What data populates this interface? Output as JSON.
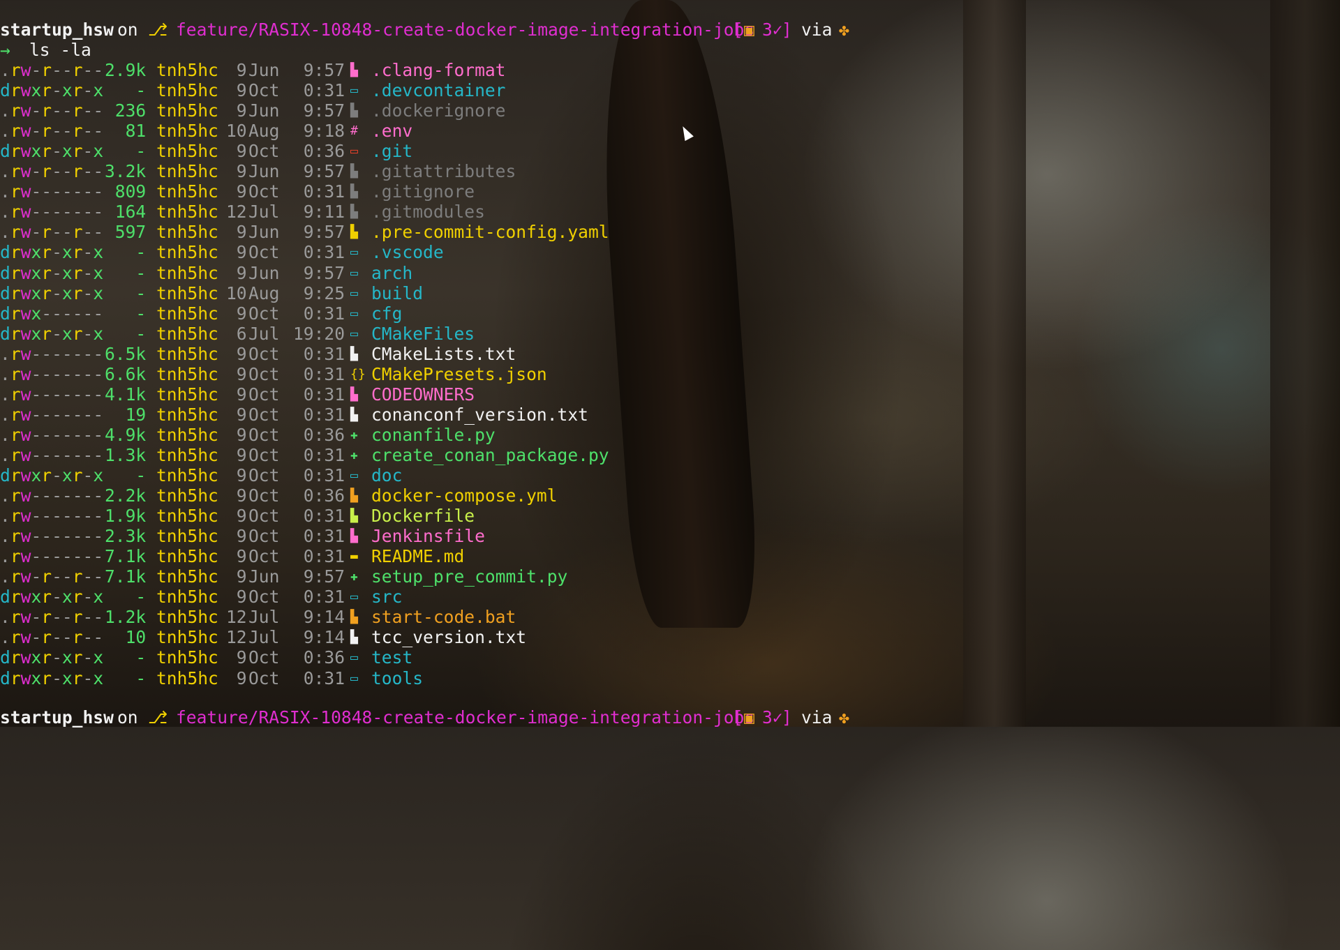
{
  "prompt": {
    "dir": "startup_hsw",
    "on": "on",
    "branch_icon": "git-branch-icon",
    "branch": "feature/RASIX-10848-create-docker-image-integration-jobs",
    "status_open": "[",
    "status_count": "3✓",
    "status_close": "]",
    "via": "via",
    "arrow": "→",
    "command": "ls -la"
  },
  "colors": {
    "perm_dir": "#25b7c8",
    "perm_read": "#f0d000",
    "perm_write": "#e02ed0",
    "perm_exec": "#4ee06a",
    "size": "#4ee06a",
    "user": "#f0d000",
    "date": "#9a9a9a",
    "branch": "#e02ed0"
  },
  "listing": [
    {
      "perm": ".rw-r--r--",
      "size": "2.9k",
      "user": "tnh5hc",
      "day": " 9",
      "month": "Jun",
      "time": " 9:57",
      "icon": "file-icon",
      "iconcolor": "#ff6dcc",
      "name": ".clang-format",
      "namecolor": "#ff6dcc"
    },
    {
      "perm": "drwxr-xr-x",
      "size": "   -",
      "user": "tnh5hc",
      "day": " 9",
      "month": "Oct",
      "time": " 0:31",
      "icon": "folder-icon",
      "iconcolor": "#25b7c8",
      "name": ".devcontainer",
      "namecolor": "#25b7c8"
    },
    {
      "perm": ".rw-r--r--",
      "size": " 236",
      "user": "tnh5hc",
      "day": " 9",
      "month": "Jun",
      "time": " 9:57",
      "icon": "file-icon",
      "iconcolor": "#7d7d7d",
      "name": ".dockerignore",
      "namecolor": "#7d7d7d"
    },
    {
      "perm": ".rw-r--r--",
      "size": "  81",
      "user": "tnh5hc",
      "day": "10",
      "month": "Aug",
      "time": " 9:18",
      "icon": "hash-icon",
      "iconcolor": "#ff6dcc",
      "name": ".env",
      "namecolor": "#ff6dcc"
    },
    {
      "perm": "drwxr-xr-x",
      "size": "   -",
      "user": "tnh5hc",
      "day": " 9",
      "month": "Oct",
      "time": " 0:36",
      "icon": "folder-icon",
      "iconcolor": "#e8402a",
      "name": ".git",
      "namecolor": "#25b7c8"
    },
    {
      "perm": ".rw-r--r--",
      "size": "3.2k",
      "user": "tnh5hc",
      "day": " 9",
      "month": "Jun",
      "time": " 9:57",
      "icon": "file-icon",
      "iconcolor": "#7d7d7d",
      "name": ".gitattributes",
      "namecolor": "#7d7d7d"
    },
    {
      "perm": ".rw-------",
      "size": " 809",
      "user": "tnh5hc",
      "day": " 9",
      "month": "Oct",
      "time": " 0:31",
      "icon": "file-icon",
      "iconcolor": "#7d7d7d",
      "name": ".gitignore",
      "namecolor": "#7d7d7d"
    },
    {
      "perm": ".rw-------",
      "size": " 164",
      "user": "tnh5hc",
      "day": "12",
      "month": "Jul",
      "time": " 9:11",
      "icon": "file-icon",
      "iconcolor": "#7d7d7d",
      "name": ".gitmodules",
      "namecolor": "#7d7d7d"
    },
    {
      "perm": ".rw-r--r--",
      "size": " 597",
      "user": "tnh5hc",
      "day": " 9",
      "month": "Jun",
      "time": " 9:57",
      "icon": "file-icon",
      "iconcolor": "#f0d000",
      "name": ".pre-commit-config.yaml",
      "namecolor": "#f0d000"
    },
    {
      "perm": "drwxr-xr-x",
      "size": "   -",
      "user": "tnh5hc",
      "day": " 9",
      "month": "Oct",
      "time": " 0:31",
      "icon": "folder-icon",
      "iconcolor": "#25b7c8",
      "name": ".vscode",
      "namecolor": "#25b7c8"
    },
    {
      "perm": "drwxr-xr-x",
      "size": "   -",
      "user": "tnh5hc",
      "day": " 9",
      "month": "Jun",
      "time": " 9:57",
      "icon": "folder-icon",
      "iconcolor": "#25b7c8",
      "name": "arch",
      "namecolor": "#25b7c8"
    },
    {
      "perm": "drwxr-xr-x",
      "size": "   -",
      "user": "tnh5hc",
      "day": "10",
      "month": "Aug",
      "time": " 9:25",
      "icon": "folder-icon",
      "iconcolor": "#25b7c8",
      "name": "build",
      "namecolor": "#25b7c8"
    },
    {
      "perm": "drwx------",
      "size": "   -",
      "user": "tnh5hc",
      "day": " 9",
      "month": "Oct",
      "time": " 0:31",
      "icon": "folder-icon",
      "iconcolor": "#25b7c8",
      "name": "cfg",
      "namecolor": "#25b7c8"
    },
    {
      "perm": "drwxr-xr-x",
      "size": "   -",
      "user": "tnh5hc",
      "day": " 6",
      "month": "Jul",
      "time": "19:20",
      "icon": "folder-icon",
      "iconcolor": "#25b7c8",
      "name": "CMakeFiles",
      "namecolor": "#25b7c8"
    },
    {
      "perm": ".rw-------",
      "size": "6.5k",
      "user": "tnh5hc",
      "day": " 9",
      "month": "Oct",
      "time": " 0:31",
      "icon": "file-icon",
      "iconcolor": "#f2f2f2",
      "name": "CMakeLists.txt",
      "namecolor": "#f2f2f2"
    },
    {
      "perm": ".rw-------",
      "size": "6.6k",
      "user": "tnh5hc",
      "day": " 9",
      "month": "Oct",
      "time": " 0:31",
      "icon": "braces-icon",
      "iconcolor": "#f0d000",
      "name": "CMakePresets.json",
      "namecolor": "#f0d000"
    },
    {
      "perm": ".rw-------",
      "size": "4.1k",
      "user": "tnh5hc",
      "day": " 9",
      "month": "Oct",
      "time": " 0:31",
      "icon": "file-icon",
      "iconcolor": "#ff6dcc",
      "name": "CODEOWNERS",
      "namecolor": "#ff6dcc"
    },
    {
      "perm": ".rw-------",
      "size": "  19",
      "user": "tnh5hc",
      "day": " 9",
      "month": "Oct",
      "time": " 0:31",
      "icon": "file-icon",
      "iconcolor": "#f2f2f2",
      "name": "conanconf_version.txt",
      "namecolor": "#f2f2f2"
    },
    {
      "perm": ".rw-------",
      "size": "4.9k",
      "user": "tnh5hc",
      "day": " 9",
      "month": "Oct",
      "time": " 0:36",
      "icon": "python-icon",
      "iconcolor": "#4ee06a",
      "name": "conanfile.py",
      "namecolor": "#4ee06a"
    },
    {
      "perm": ".rw-------",
      "size": "1.3k",
      "user": "tnh5hc",
      "day": " 9",
      "month": "Oct",
      "time": " 0:31",
      "icon": "python-icon",
      "iconcolor": "#4ee06a",
      "name": "create_conan_package.py",
      "namecolor": "#4ee06a"
    },
    {
      "perm": "drwxr-xr-x",
      "size": "   -",
      "user": "tnh5hc",
      "day": " 9",
      "month": "Oct",
      "time": " 0:31",
      "icon": "folder-icon",
      "iconcolor": "#25b7c8",
      "name": "doc",
      "namecolor": "#25b7c8"
    },
    {
      "perm": ".rw-------",
      "size": "2.2k",
      "user": "tnh5hc",
      "day": " 9",
      "month": "Oct",
      "time": " 0:36",
      "icon": "file-icon",
      "iconcolor": "#f0a020",
      "name": "docker-compose.yml",
      "namecolor": "#f0d000"
    },
    {
      "perm": ".rw-------",
      "size": "1.9k",
      "user": "tnh5hc",
      "day": " 9",
      "month": "Oct",
      "time": " 0:31",
      "icon": "file-icon",
      "iconcolor": "#c9f04a",
      "name": "Dockerfile",
      "namecolor": "#c9f04a"
    },
    {
      "perm": ".rw-------",
      "size": "2.3k",
      "user": "tnh5hc",
      "day": " 9",
      "month": "Oct",
      "time": " 0:31",
      "icon": "file-icon",
      "iconcolor": "#ff6dcc",
      "name": "Jenkinsfile",
      "namecolor": "#ff6dcc"
    },
    {
      "perm": ".rw-------",
      "size": "7.1k",
      "user": "tnh5hc",
      "day": " 9",
      "month": "Oct",
      "time": " 0:31",
      "icon": "markdown-icon",
      "iconcolor": "#f0d000",
      "name": "README.md",
      "namecolor": "#f0d000"
    },
    {
      "perm": ".rw-r--r--",
      "size": "7.1k",
      "user": "tnh5hc",
      "day": " 9",
      "month": "Jun",
      "time": " 9:57",
      "icon": "python-icon",
      "iconcolor": "#4ee06a",
      "name": "setup_pre_commit.py",
      "namecolor": "#4ee06a"
    },
    {
      "perm": "drwxr-xr-x",
      "size": "   -",
      "user": "tnh5hc",
      "day": " 9",
      "month": "Oct",
      "time": " 0:31",
      "icon": "folder-icon",
      "iconcolor": "#25b7c8",
      "name": "src",
      "namecolor": "#25b7c8"
    },
    {
      "perm": ".rw-r--r--",
      "size": "1.2k",
      "user": "tnh5hc",
      "day": "12",
      "month": "Jul",
      "time": " 9:14",
      "icon": "file-icon",
      "iconcolor": "#f0a020",
      "name": "start-code.bat",
      "namecolor": "#f0a020"
    },
    {
      "perm": ".rw-r--r--",
      "size": "  10",
      "user": "tnh5hc",
      "day": "12",
      "month": "Jul",
      "time": " 9:14",
      "icon": "file-icon",
      "iconcolor": "#f2f2f2",
      "name": "tcc_version.txt",
      "namecolor": "#f2f2f2"
    },
    {
      "perm": "drwxr-xr-x",
      "size": "   -",
      "user": "tnh5hc",
      "day": " 9",
      "month": "Oct",
      "time": " 0:36",
      "icon": "folder-icon",
      "iconcolor": "#25b7c8",
      "name": "test",
      "namecolor": "#25b7c8"
    },
    {
      "perm": "drwxr-xr-x",
      "size": "   -",
      "user": "tnh5hc",
      "day": " 9",
      "month": "Oct",
      "time": " 0:31",
      "icon": "folder-icon",
      "iconcolor": "#25b7c8",
      "name": "tools",
      "namecolor": "#25b7c8"
    }
  ]
}
